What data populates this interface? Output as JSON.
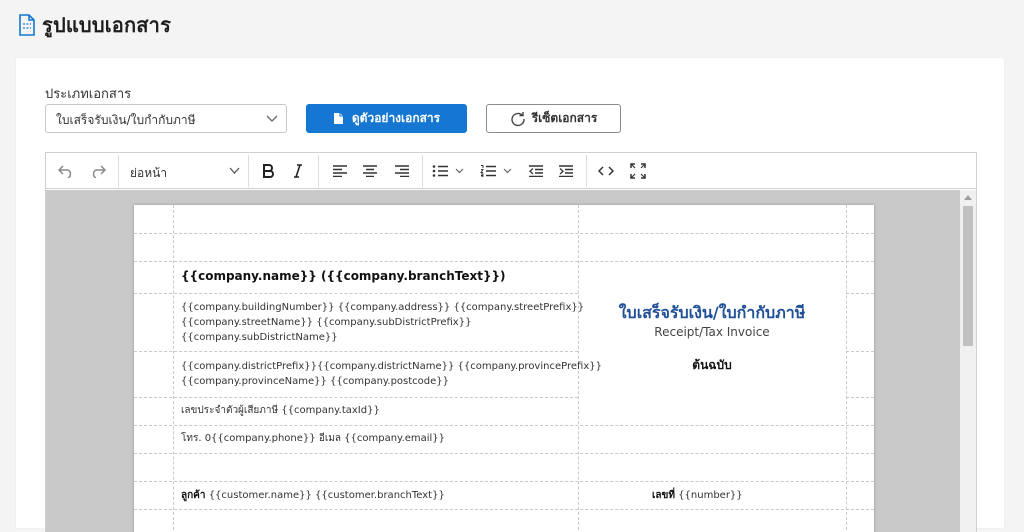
{
  "page": {
    "title": "รูปแบบเอกสาร"
  },
  "form": {
    "doc_type_label": "ประเภทเอกสาร",
    "doc_type_value": "ใบเสร็จรับเงิน/ใบกำกับภาษี",
    "preview_button": "ดูตัวอย่างเอกสาร",
    "reset_button": "รีเซ็ตเอกสาร"
  },
  "toolbar": {
    "heading_select": "ย่อหน้า"
  },
  "document": {
    "company_line": "{{company.name}} ({{company.branchText}})",
    "address_line1": "{{company.buildingNumber}} {{company.address}} {{company.streetPrefix}}",
    "address_line2": "{{company.streetName}} {{company.subDistrictPrefix}}",
    "address_line3": "{{company.subDistrictName}}",
    "address_line4": "{{company.districtPrefix}}{{company.districtName}} {{company.provincePrefix}}",
    "address_line5": "{{company.provinceName}} {{company.postcode}}",
    "tax_line": "เลขประจำตัวผู้เสียภาษี {{company.taxId}}",
    "contact_line": "โทร. 0{{company.phone}}  อีเมล {{company.email}}",
    "title_th": "ใบเสร็จรับเงิน/ใบกำกับภาษี",
    "title_en": "Receipt/Tax Invoice",
    "original_label": "ต้นฉบับ",
    "customer_label": "ลูกค้า",
    "customer_value": "{{customer.name}} {{customer.branchText}}",
    "number_label": "เลขที่",
    "number_value": "{{number}}"
  }
}
